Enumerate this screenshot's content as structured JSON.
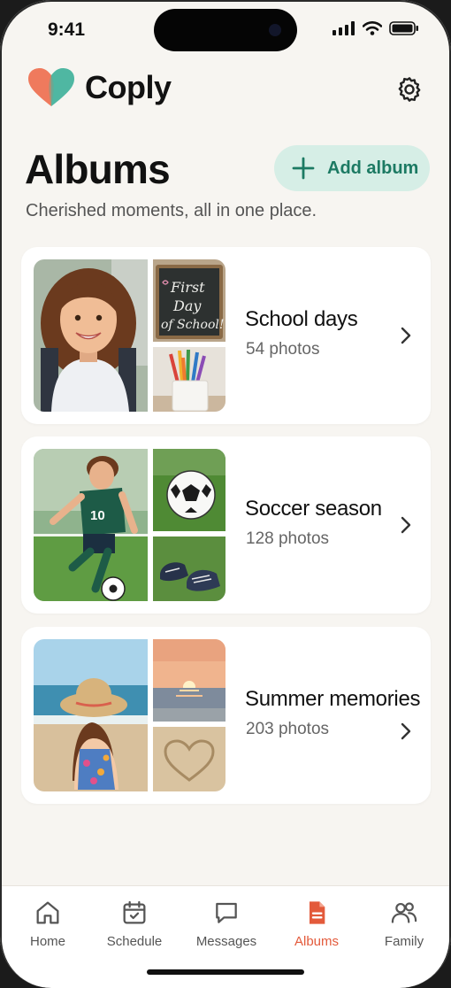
{
  "status_bar": {
    "time": "9:41"
  },
  "app": {
    "name": "Coply"
  },
  "header": {
    "title": "Albums",
    "subtitle": "Cherished moments, all in one place.",
    "add_label": "Add album"
  },
  "albums": [
    {
      "name": "School days",
      "count": "54 photos",
      "chalkboard_text": "First Day of School!"
    },
    {
      "name": "Soccer season",
      "count": "128 photos",
      "jersey_number": "10"
    },
    {
      "name": "Summer memories",
      "count": "203 photos"
    }
  ],
  "tabs": [
    {
      "label": "Home",
      "icon": "home-icon"
    },
    {
      "label": "Schedule",
      "icon": "calendar-icon"
    },
    {
      "label": "Messages",
      "icon": "message-icon"
    },
    {
      "label": "Albums",
      "icon": "album-icon",
      "active": true
    },
    {
      "label": "Family",
      "icon": "family-icon"
    }
  ],
  "colors": {
    "accent": "#e35a3b",
    "add_button_bg": "#d6eee6",
    "add_button_text": "#1c7a63",
    "background": "#f7f5f1"
  }
}
